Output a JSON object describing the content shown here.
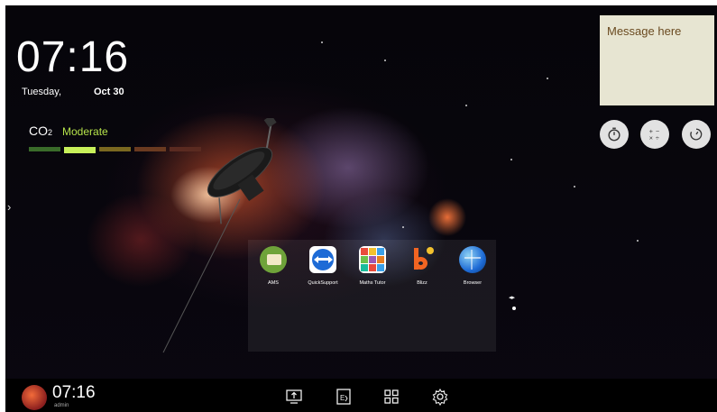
{
  "clock": {
    "time": "07:16",
    "day": "Tuesday,",
    "date": "Oct 30"
  },
  "co2": {
    "label": "CO",
    "subscript": "2",
    "level": "Moderate",
    "bars": [
      "#3a6b2a",
      "#c8f05a",
      "#7a6820",
      "#6a3a20",
      "#5a2a20"
    ],
    "accent": "#b5e34a"
  },
  "sticky_note": {
    "text": "Message here",
    "background": "#e7e5d2"
  },
  "tools": [
    {
      "name": "timer-button",
      "icon": "stopwatch-icon"
    },
    {
      "name": "calculator-button",
      "icon": "calculator-icon"
    },
    {
      "name": "countdown-button",
      "icon": "countdown-icon"
    }
  ],
  "apps": [
    {
      "label": "AMS",
      "icon": "ams-icon"
    },
    {
      "label": "QuickSupport",
      "icon": "quicksupport-icon"
    },
    {
      "label": "Maths Tutor",
      "icon": "maths-tutor-icon"
    },
    {
      "label": "Blizz",
      "icon": "blizz-icon"
    },
    {
      "label": "Browser",
      "icon": "browser-icon"
    }
  ],
  "taskbar": {
    "time": "07:16",
    "user": "admin",
    "buttons": [
      "screen-share-icon",
      "whiteboard-icon",
      "apps-grid-icon",
      "settings-icon"
    ]
  }
}
